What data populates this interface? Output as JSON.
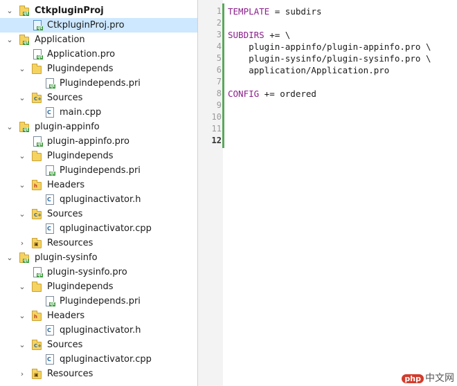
{
  "tree": {
    "items": [
      {
        "label": "CtkpluginProj",
        "depth": 0,
        "expanded": true,
        "icon": "project-folder-icon",
        "kind": "folder",
        "bold": true
      },
      {
        "label": "CtkpluginProj.pro",
        "depth": 1,
        "icon": "pro-file-icon",
        "kind": "file",
        "selected": true
      },
      {
        "label": "Application",
        "depth": 0,
        "expanded": true,
        "icon": "project-folder-icon",
        "kind": "folder"
      },
      {
        "label": "Application.pro",
        "depth": 1,
        "icon": "pro-file-icon",
        "kind": "file"
      },
      {
        "label": "Plugindepends",
        "depth": 1,
        "expanded": true,
        "icon": "folder-icon",
        "kind": "folder"
      },
      {
        "label": "Plugindepends.pri",
        "depth": 2,
        "icon": "pri-file-icon",
        "kind": "file"
      },
      {
        "label": "Sources",
        "depth": 1,
        "expanded": true,
        "icon": "sources-folder-icon",
        "kind": "folder",
        "tag": "C++"
      },
      {
        "label": "main.cpp",
        "depth": 2,
        "icon": "cpp-file-icon",
        "kind": "file",
        "tag": "C"
      },
      {
        "label": "plugin-appinfo",
        "depth": 0,
        "expanded": true,
        "icon": "project-folder-icon",
        "kind": "folder"
      },
      {
        "label": "plugin-appinfo.pro",
        "depth": 1,
        "icon": "pro-file-icon",
        "kind": "file"
      },
      {
        "label": "Plugindepends",
        "depth": 1,
        "expanded": true,
        "icon": "folder-icon",
        "kind": "folder"
      },
      {
        "label": "Plugindepends.pri",
        "depth": 2,
        "icon": "pri-file-icon",
        "kind": "file"
      },
      {
        "label": "Headers",
        "depth": 1,
        "expanded": true,
        "icon": "headers-folder-icon",
        "kind": "folder",
        "tag": "h"
      },
      {
        "label": "qpluginactivator.h",
        "depth": 2,
        "icon": "header-file-icon",
        "kind": "file",
        "tag": "C"
      },
      {
        "label": "Sources",
        "depth": 1,
        "expanded": true,
        "icon": "sources-folder-icon",
        "kind": "folder",
        "tag": "C++"
      },
      {
        "label": "qpluginactivator.cpp",
        "depth": 2,
        "icon": "cpp-file-icon",
        "kind": "file",
        "tag": "C"
      },
      {
        "label": "Resources",
        "depth": 1,
        "expanded": false,
        "icon": "resources-folder-icon",
        "kind": "folder",
        "tag": "lock"
      },
      {
        "label": "plugin-sysinfo",
        "depth": 0,
        "expanded": true,
        "icon": "project-folder-icon",
        "kind": "folder"
      },
      {
        "label": "plugin-sysinfo.pro",
        "depth": 1,
        "icon": "pro-file-icon",
        "kind": "file"
      },
      {
        "label": "Plugindepends",
        "depth": 1,
        "expanded": true,
        "icon": "folder-icon",
        "kind": "folder"
      },
      {
        "label": "Plugindepends.pri",
        "depth": 2,
        "icon": "pri-file-icon",
        "kind": "file"
      },
      {
        "label": "Headers",
        "depth": 1,
        "expanded": true,
        "icon": "headers-folder-icon",
        "kind": "folder",
        "tag": "h"
      },
      {
        "label": "qpluginactivator.h",
        "depth": 2,
        "icon": "header-file-icon",
        "kind": "file",
        "tag": "C"
      },
      {
        "label": "Sources",
        "depth": 1,
        "expanded": true,
        "icon": "sources-folder-icon",
        "kind": "folder",
        "tag": "C++"
      },
      {
        "label": "qpluginactivator.cpp",
        "depth": 2,
        "icon": "cpp-file-icon",
        "kind": "file",
        "tag": "C"
      },
      {
        "label": "Resources",
        "depth": 1,
        "expanded": false,
        "icon": "resources-folder-icon",
        "kind": "folder",
        "tag": "lock"
      }
    ]
  },
  "editor": {
    "current_line": 12,
    "line_numbers": [
      "1",
      "2",
      "3",
      "4",
      "5",
      "6",
      "7",
      "8",
      "9",
      "10",
      "11",
      "12"
    ],
    "lines": [
      [
        {
          "t": "TEMPLATE",
          "k": true
        },
        {
          "t": " = subdirs"
        }
      ],
      [],
      [
        {
          "t": "SUBDIRS",
          "k": true
        },
        {
          "t": " += \\"
        }
      ],
      [
        {
          "t": "    plugin-appinfo/plugin-appinfo.pro \\"
        }
      ],
      [
        {
          "t": "    plugin-sysinfo/plugin-sysinfo.pro \\"
        }
      ],
      [
        {
          "t": "    application/Application.pro"
        }
      ],
      [],
      [
        {
          "t": "CONFIG",
          "k": true
        },
        {
          "t": " += ordered"
        }
      ],
      [],
      [],
      [],
      []
    ]
  },
  "watermark": {
    "badge": "php",
    "text": "中文网"
  },
  "colors": {
    "selection": "#cde8ff",
    "keyword": "#8b1d8b",
    "gutter_marker": "#5aa85a",
    "folder": "#f5d361"
  }
}
